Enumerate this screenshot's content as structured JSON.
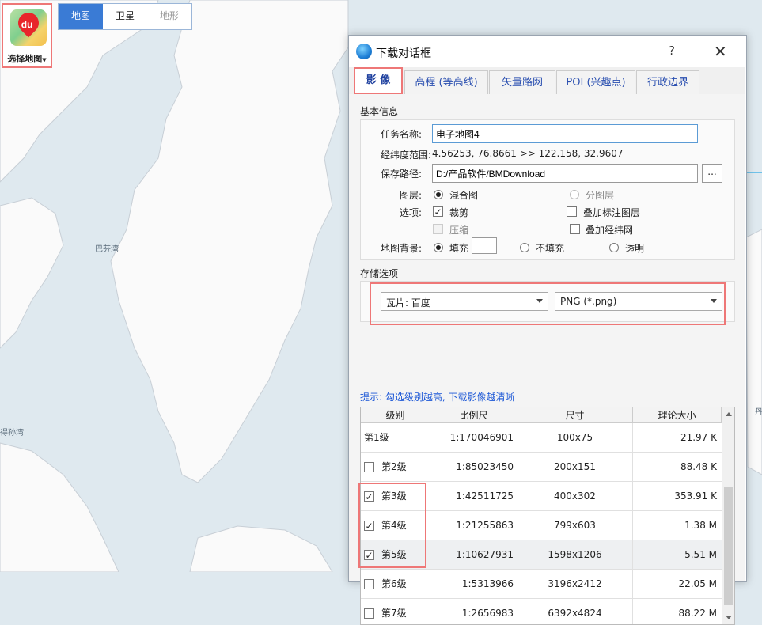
{
  "map": {
    "labels": [
      "巴芬湾",
      "得孙湾",
      "丹"
    ],
    "chooser_label": "选择地图",
    "logo_text": "du",
    "types": [
      {
        "label": "地图",
        "state": "active"
      },
      {
        "label": "卫星",
        "state": "normal"
      },
      {
        "label": "地形",
        "state": "disabled"
      }
    ]
  },
  "dialog": {
    "title": "下载对话框",
    "help": "?",
    "close": "✕",
    "tabs": [
      "影 像",
      "高程 (等高线)",
      "矢量路网",
      "POI (兴趣点)",
      "行政边界"
    ],
    "basic_title": "基本信息",
    "task_label": "任务名称:",
    "task_value": "电子地图4",
    "range_label": "经纬度范围:",
    "range_value": "4.56253, 76.8661    >>    122.158, 32.9607",
    "path_label": "保存路径:",
    "path_value": "D:/产品软件/BMDownload",
    "browse": "...",
    "layer_label": "图层:",
    "layer_mixed": "混合图",
    "layer_split": "分图层",
    "options_label": "选项:",
    "opt_crop": "裁剪",
    "opt_compress": "压缩",
    "opt_overlay_label": "叠加标注图层",
    "opt_overlay_grid": "叠加经纬网",
    "bg_label": "地图背景:",
    "bg_fill": "填充",
    "bg_nofill": "不填充",
    "bg_transparent": "透明",
    "storage_title": "存储选项",
    "tile_source": "瓦片: 百度",
    "format": "PNG (*.png)",
    "tip": "提示: 勾选级别越高, 下载影像越清晰",
    "table": {
      "headers": [
        "级别",
        "比例尺",
        "尺寸",
        "理论大小"
      ],
      "rows": [
        {
          "level": "第1级",
          "scale": "1:170046901",
          "size": "100x75",
          "est": "21.97 K",
          "checked": null
        },
        {
          "level": "第2级",
          "scale": "1:85023450",
          "size": "200x151",
          "est": "88.48 K",
          "checked": false
        },
        {
          "level": "第3级",
          "scale": "1:42511725",
          "size": "400x302",
          "est": "353.91 K",
          "checked": true
        },
        {
          "level": "第4级",
          "scale": "1:21255863",
          "size": "799x603",
          "est": "1.38 M",
          "checked": true
        },
        {
          "level": "第5级",
          "scale": "1:10627931",
          "size": "1598x1206",
          "est": "5.51 M",
          "checked": true
        },
        {
          "level": "第6级",
          "scale": "1:5313966",
          "size": "3196x2412",
          "est": "22.05 M",
          "checked": false
        },
        {
          "level": "第7级",
          "scale": "1:2656983",
          "size": "6392x4824",
          "est": "88.22 M",
          "checked": false
        }
      ]
    }
  },
  "colors": {
    "accent": "#3a7bd5",
    "highlight_frame": "#e77777",
    "tip": "#1a56d6",
    "land": "#fafafa",
    "water": "#dfe9ef"
  }
}
